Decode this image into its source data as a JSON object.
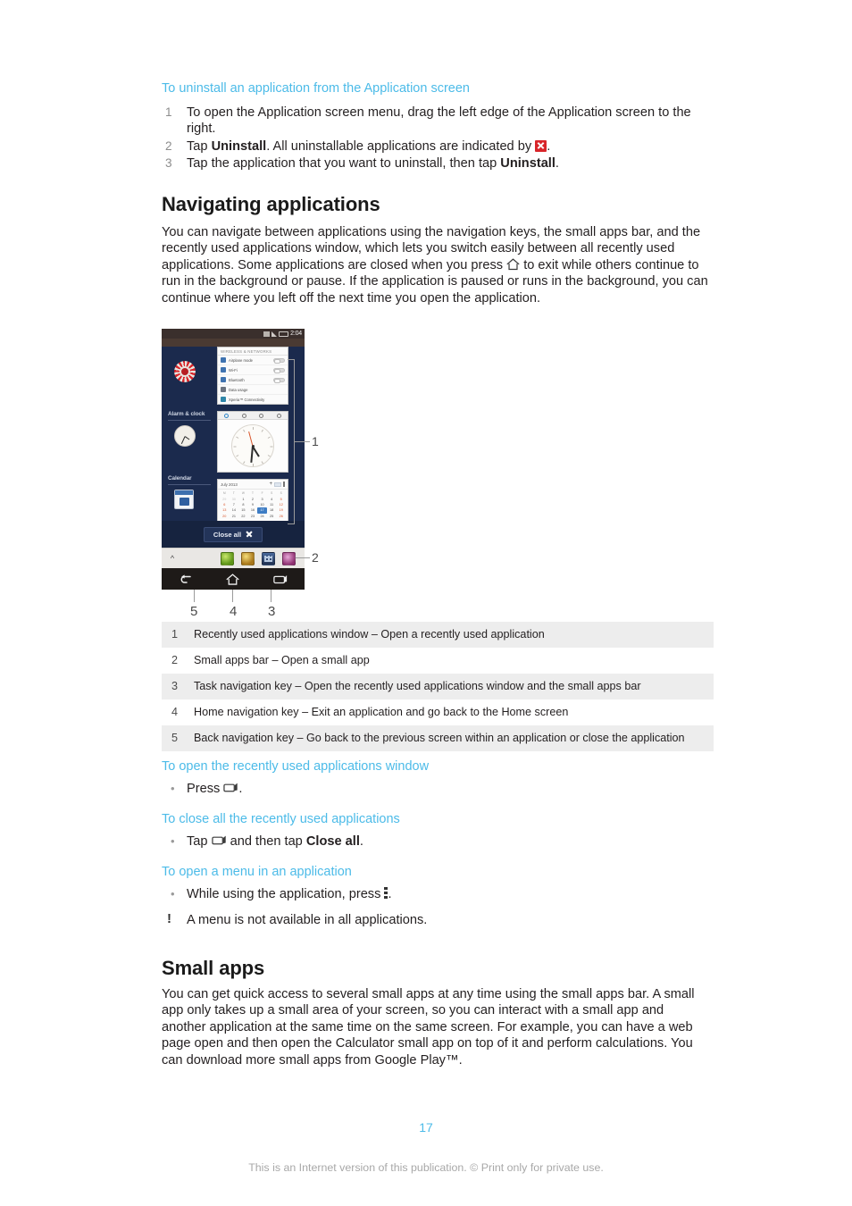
{
  "document": {
    "page_number": "17",
    "disclaimer": "This is an Internet version of this publication. © Print only for private use.",
    "accent_color": "#4cbbe8",
    "table_shade_color": "#ededed"
  },
  "section_uninstall": {
    "heading": "To uninstall an application from the Application screen",
    "steps": [
      {
        "num": "1",
        "text": "To open the Application screen menu, drag the left edge of the Application screen to the right."
      },
      {
        "num": "2",
        "prefix": "Tap ",
        "bold": "Uninstall",
        "mid": ". All uninstallable applications are indicated by ",
        "icon": "uninstall-x-icon",
        "suffix": "."
      },
      {
        "num": "3",
        "prefix": "Tap the application that you want to uninstall, then tap ",
        "bold": "Uninstall",
        "suffix": "."
      }
    ]
  },
  "section_navigating": {
    "title": "Navigating applications",
    "paragraph_part1": "You can navigate between applications using the navigation keys, the small apps bar, and the recently used applications window, which lets you switch easily between all recently used applications. Some applications are closed when you press ",
    "paragraph_inline_icon": "home-key-icon",
    "paragraph_part2": " to exit while others continue to run in the background or pause. If the application is paused or runs in the background, you can continue where you left off the next time you open the application."
  },
  "figure": {
    "status_bar": {
      "time": "2:04"
    },
    "app_entries": [
      {
        "label": "",
        "icon": "settings-gear-icon"
      },
      {
        "label": "Alarm & clock",
        "icon": "clock-icon"
      },
      {
        "label": "Calendar",
        "icon": "calendar-icon"
      }
    ],
    "settings_card": {
      "title": "WIRELESS & NETWORKS",
      "rows": [
        {
          "label": "Airplane mode",
          "toggle": true
        },
        {
          "label": "Wi-Fi",
          "toggle": true
        },
        {
          "label": "Bluetooth",
          "toggle": true
        },
        {
          "label": "Data usage",
          "toggle": false
        },
        {
          "label": "Xperia™ Connectivity",
          "toggle": false
        }
      ]
    },
    "calendar_card": {
      "month": "July 2013",
      "weekdays": [
        "M",
        "T",
        "W",
        "T",
        "F",
        "S",
        "S"
      ],
      "weeks": [
        [
          "29",
          "30",
          "1",
          "2",
          "3",
          "4",
          "5"
        ],
        [
          "6",
          "7",
          "8",
          "9",
          "10",
          "11",
          "12"
        ],
        [
          "13",
          "14",
          "15",
          "16",
          "17",
          "18",
          "19"
        ],
        [
          "20",
          "21",
          "22",
          "23",
          "24",
          "25",
          "26"
        ]
      ],
      "selected_day": "17"
    },
    "close_all_button": "Close all",
    "small_apps_icons": [
      "small-app-green-icon",
      "small-app-gold-icon",
      "small-app-calculator-icon",
      "small-app-pink-icon"
    ],
    "nav_keys": [
      "back-navigation-key",
      "home-navigation-key",
      "task-navigation-key"
    ],
    "callouts": [
      "1",
      "2",
      "3",
      "4",
      "5"
    ]
  },
  "legend_table": {
    "rows": [
      {
        "num": "1",
        "desc": "Recently used applications window – Open a recently used application",
        "shaded": true
      },
      {
        "num": "2",
        "desc": "Small apps bar – Open a small app",
        "shaded": false
      },
      {
        "num": "3",
        "desc": "Task navigation key – Open the recently used applications window and the small apps bar",
        "shaded": true
      },
      {
        "num": "4",
        "desc": "Home navigation key – Exit an application and go back to the Home screen",
        "shaded": false
      },
      {
        "num": "5",
        "desc": "Back navigation key – Go back to the previous screen within an application or close the application",
        "shaded": true
      }
    ]
  },
  "section_open_recent": {
    "heading": "To open the recently used applications window",
    "text_prefix": "Press ",
    "icon": "task-key-icon",
    "text_suffix": "."
  },
  "section_close_all": {
    "heading": "To close all the recently used applications",
    "text_prefix": "Tap ",
    "icon": "task-key-icon",
    "text_mid": " and then tap ",
    "bold": "Close all",
    "text_suffix": "."
  },
  "section_open_menu": {
    "heading": "To open a menu in an application",
    "text_prefix": "While using the application, press ",
    "icon": "overflow-menu-icon",
    "text_suffix": ".",
    "note": "A menu is not available in all applications."
  },
  "section_small_apps": {
    "title": "Small apps",
    "paragraph": "You can get quick access to several small apps at any time using the small apps bar. A small app only takes up a small area of your screen, so you can interact with a small app and another application at the same time on the same screen. For example, you can have a web page open and then open the Calculator small app on top of it and perform calculations. You can download more small apps from Google Play™."
  }
}
